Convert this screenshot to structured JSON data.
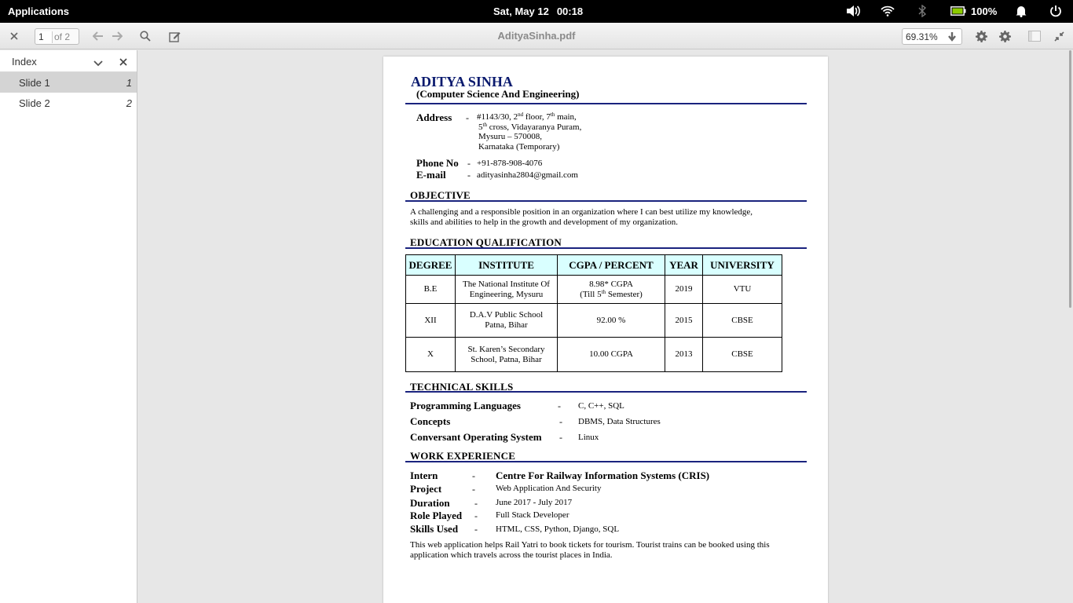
{
  "topbar": {
    "applications": "Applications",
    "date": "Sat, May 12",
    "time": "00:18",
    "battery": "100%"
  },
  "toolbar": {
    "page_current": "1",
    "page_of": "of 2",
    "title": "AdityaSinha.pdf",
    "zoom": "69.31%"
  },
  "sidebar": {
    "title": "Index",
    "items": [
      {
        "label": "Slide 1",
        "page": "1"
      },
      {
        "label": "Slide 2",
        "page": "2"
      }
    ]
  },
  "resume": {
    "name": "ADITYA SINHA",
    "branch": "(Computer Science And Engineering)",
    "address_label": "Address",
    "address_lines": [
      "#1143/30, 2nd floor, 7th main,",
      "5th cross, Vidayaranya Puram,",
      "Mysuru – 570008,",
      "Karnataka (Temporary)"
    ],
    "phone_label": "Phone No",
    "phone": "+91-878-908-4076",
    "email_label": "E-mail",
    "email": "adityasinha2804@gmail.com",
    "objective_title": "OBJECTIVE",
    "objective": [
      "A challenging and a responsible position in an organization where I can best utilize my knowledge,",
      "skills and abilities to help in the growth and development of my organization."
    ],
    "education_title": "EDUCATION QUALIFICATION",
    "education_headers": [
      "DEGREE",
      "INSTITUTE",
      "CGPA / PERCENT",
      "YEAR",
      "UNIVERSITY"
    ],
    "education_rows": [
      {
        "degree": "B.E",
        "institute": [
          "The National Institute Of",
          "Engineering, Mysuru"
        ],
        "score": [
          "8.98* CGPA",
          "(Till 5th Semester)"
        ],
        "year": "2019",
        "university": "VTU"
      },
      {
        "degree": "XII",
        "institute": [
          "D.A.V Public School",
          "Patna, Bihar"
        ],
        "score": [
          "92.00 %"
        ],
        "year": "2015",
        "university": "CBSE"
      },
      {
        "degree": "X",
        "institute": [
          "St. Karen’s Secondary",
          "School, Patna, Bihar"
        ],
        "score": [
          "10.00 CGPA"
        ],
        "year": "2013",
        "university": "CBSE"
      }
    ],
    "skills_title": "TECHNICAL SKILLS",
    "skills": [
      {
        "label": "Programming Languages",
        "value": "C, C++, SQL"
      },
      {
        "label": "Concepts",
        "value": "DBMS, Data Structures"
      },
      {
        "label": "Conversant Operating System",
        "value": "Linux"
      }
    ],
    "work_title": "WORK EXPERIENCE",
    "work": [
      {
        "label": "Intern",
        "value": "Centre For Railway Information Systems (CRIS)"
      },
      {
        "label": "Project",
        "value": "Web Application And Security"
      },
      {
        "label": "Duration",
        "value": "June 2017 - July 2017"
      },
      {
        "label": "Role Played",
        "value": "Full Stack Developer"
      },
      {
        "label": "Skills Used",
        "value": "HTML, CSS, Python, Django, SQL"
      }
    ],
    "work_desc": [
      "This web application helps Rail Yatri to book tickets for tourism. Tourist trains can be booked using this",
      "application which travels across the tourist places in India."
    ]
  }
}
